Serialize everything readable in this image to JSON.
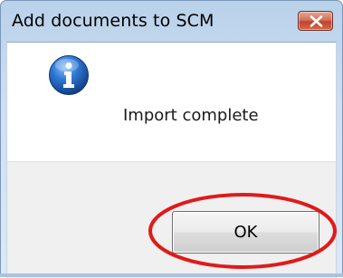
{
  "dialog": {
    "title": "Add documents to SCM",
    "message": "Import complete",
    "ok_label": "OK"
  },
  "icons": {
    "info": "info-icon",
    "close": "close-icon"
  },
  "colors": {
    "close_button": "#c8553a",
    "info_icon": "#1f5fb0",
    "highlight": "#e01a1a"
  }
}
